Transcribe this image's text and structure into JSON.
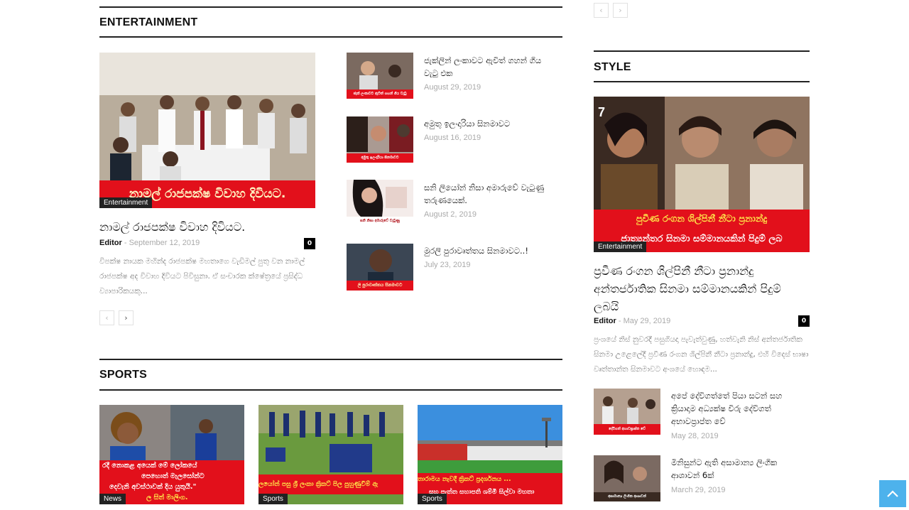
{
  "pager_top": {
    "prev": "‹",
    "next": "›"
  },
  "entertainment": {
    "title": "ENTERTAINMENT",
    "main": {
      "banner": "නාමල් රාජපක්ෂ විවාහ දිවියට.",
      "category": "Entertainment",
      "headline": "නාමල් රාජපක්ෂ විවාහ දිවියට.",
      "author": "Editor",
      "date": "September 12, 2019",
      "comments": "0",
      "excerpt": "විපක්ෂ නායක මහින්ද රාජපක්ෂ මහතාගෙ වැඩිමල් පුතු වන නාමල් රාජපක්ෂ අද විවාහ දිවියට පිවිසුනා. ඒ සංචාරක ක්ෂේත්‍රයේ ප්‍රසිද්ධ ව්‍යාපාරිකයකු..."
    },
    "list": [
      {
        "title": "ජැක්ලින් ලංකාවට ඇවිත් ගහන් ගිය වැටු එක",
        "date": "August 29, 2019",
        "strip": "ජැක් ලංකාවට ඇවිත් ගහන් ගිය වැටු"
      },
      {
        "title": "අමුතු ඉලංදාරියා සිනමාවට",
        "date": "August 16, 2019",
        "strip": "අමුතු ඉලංදාරියා සිනමාවට"
      },
      {
        "title": "සනි ලියෝන් නිසා අමාරුවේ වැටුණු තරුණයෙක්.",
        "date": "August 2, 2019",
        "strip": "සනි නිසා අමාරුවේ වැටුණු"
      },
      {
        "title": "මුරලි පුරාවෘත්තය සිනමාවට..!",
        "date": "July 23, 2019",
        "strip": "ලි පුරාවෘත්තය සිනමාවට"
      }
    ],
    "pager": {
      "prev": "‹",
      "next": "›"
    }
  },
  "sports": {
    "title": "SPORTS",
    "items": [
      {
        "category": "News",
        "banner1": "රදී නොකළ අයෙක් මේ ලෝකයේ",
        "banner2": "පෙහොත් මැලසෝන්ට",
        "banner3": "දෙවැනි අවස්ථාවක් දිය යුතුයි.\"",
        "banner4": "ල සිත් මාලිංග."
      },
      {
        "category": "Sports",
        "banner1": "ලයෝන් පසු ශ්‍රී ලංකා ක්‍රිකට් පිල පුහුණුවීම් ඇ"
      },
      {
        "category": "Sports",
        "banner1": "තාරාමය නැවදී ක්‍රිකට් ප්‍රදර්ශනය ...",
        "banner2": "සහ පැත්ත සහාපති ශම්මි සිල්වා මහතා"
      }
    ]
  },
  "style": {
    "title": "STYLE",
    "main": {
      "banner1": "පුවීණ රංගන ශිල්පිනී නීටා ප්‍රනාන්දු",
      "banner2": "ජාත්‍යන්තර සිනමා සම්මානයකින් පිදුම් ලබ",
      "category": "Entertainment",
      "headline": "ප්‍රවීණ රංගන ශිල්පිනී නීටා ප්‍රනාන්දු අන්තර්ජාතික සිනමා සම්මානයකින් පිදුම් ලබයි",
      "author": "Editor",
      "date": "May 29, 2019",
      "comments": "0",
      "excerpt": "ප්‍රංශයේ නිස් නුවරදී පසුගියදා පැවැත්වුණු, හත්වැනි නිස් අන්තර්ජාතික සිනමා උළෙලේදී ප්‍රවීණ රංගන ශිල්පිනී නීටා ප්‍රනාන්දු, එහි විදෙස් භාෂා වෘත්තාන්ත සිනමාවට අංශයේ හොඳම..."
    },
    "list": [
      {
        "title": "අපේ දේවිගත්තේ පියා සටන් සහ ක්‍රියාදාම අධ්‍යක්ෂ විරු දේවිගත් අභාවප්‍රාප්ත වේ",
        "date": "May 28, 2019",
        "strip": "දේවිගත් අභාවප්‍රාප්ත වේ"
      },
      {
        "title": "මිනිසුන්ට ඇති අසාමාන්‍ය ලිංගික ආශාවන් 6ක්",
        "date": "March 29, 2019",
        "strip": "අසාමාන්‍ය ලිංගික ආශාවන්"
      }
    ]
  },
  "icons": {
    "scroll_top": "chevron-up-icon"
  }
}
